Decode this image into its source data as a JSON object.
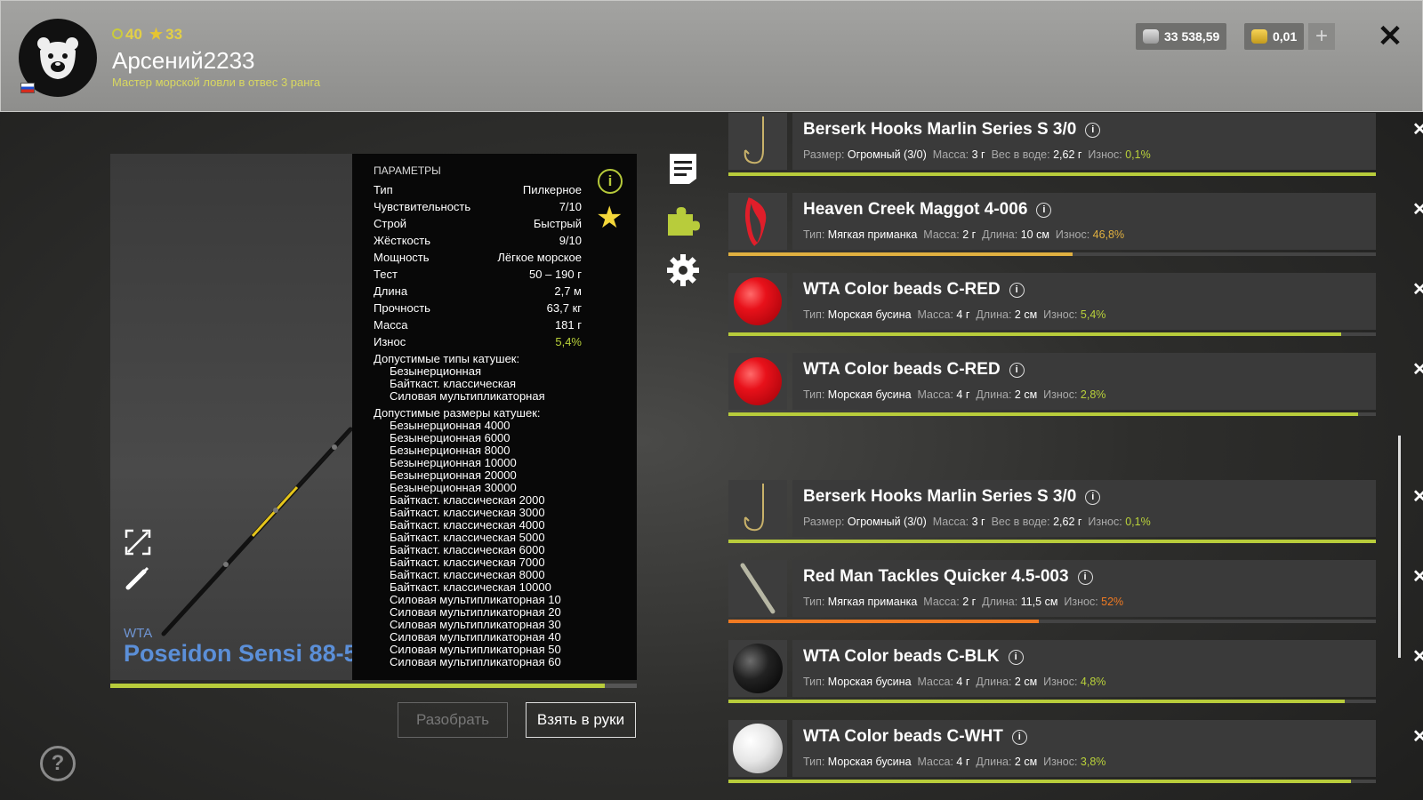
{
  "header": {
    "level": "40",
    "stars": "33",
    "username": "Арсений2233",
    "rank": "Мастер морской ловли в отвес 3 ранга",
    "silver": "33 538,59",
    "gold": "0,01",
    "plus_label": "+",
    "close_label": "✕"
  },
  "rod": {
    "brand": "WTA",
    "name": "Poseidon Sensi 88-5",
    "wear_fraction": 0.94
  },
  "params": {
    "title": "ПАРАМЕТРЫ",
    "rows": [
      {
        "k": "Тип",
        "v": "Пилкерное"
      },
      {
        "k": "Чувствительность",
        "v": "7/10"
      },
      {
        "k": "Строй",
        "v": "Быстрый"
      },
      {
        "k": "Жёсткость",
        "v": "9/10"
      },
      {
        "k": "Мощность",
        "v": "Лёгкое морское"
      },
      {
        "k": "Тест",
        "v": "50 – 190 г"
      },
      {
        "k": "Длина",
        "v": "2,7 м"
      },
      {
        "k": "Прочность",
        "v": "63,7 кг"
      },
      {
        "k": "Масса",
        "v": "181 г"
      },
      {
        "k": "Износ",
        "v": "5,4%"
      }
    ],
    "reel_types_title": "Допустимые типы катушек:",
    "reel_types": [
      "Безынерционная",
      "Байткаст. классическая",
      "Силовая мультипликаторная"
    ],
    "reel_sizes_title": "Допустимые размеры катушек:",
    "reel_sizes": [
      "Безынерционная 4000",
      "Безынерционная 6000",
      "Безынерционная 8000",
      "Безынерционная 10000",
      "Безынерционная 20000",
      "Безынерционная 30000",
      "Байткаст. классическая 2000",
      "Байткаст. классическая 3000",
      "Байткаст. классическая 4000",
      "Байткаст. классическая 5000",
      "Байткаст. классическая 6000",
      "Байткаст. классическая 7000",
      "Байткаст. классическая 8000",
      "Байткаст. классическая 10000",
      "Силовая мультипликаторная 10",
      "Силовая мультипликаторная 20",
      "Силовая мультипликаторная 30",
      "Силовая мультипликаторная 40",
      "Силовая мультипликаторная 50",
      "Силовая мультипликаторная 60"
    ]
  },
  "buttons": {
    "disassemble": "Разобрать",
    "take": "Взять в руки",
    "help": "?"
  },
  "items": [
    {
      "name": "Berserk Hooks Marlin Series S 3/0",
      "thumb": "hook-icon",
      "props": [
        [
          "Размер:",
          "Огромный (3/0)"
        ],
        [
          "Масса:",
          "3 г"
        ],
        [
          "Вес в воде:",
          "2,62 г"
        ]
      ],
      "wear_label": "Износ:",
      "wear": "0,1%",
      "wear_class": "good",
      "bar": 1.0,
      "bar_color": "#b8cc3b"
    },
    {
      "name": "Heaven Creek Maggot 4-006",
      "thumb": "maggot-icon",
      "props": [
        [
          "Тип:",
          "Мягкая приманка"
        ],
        [
          "Масса:",
          "2 г"
        ],
        [
          "Длина:",
          "10 см"
        ]
      ],
      "wear_label": "Износ:",
      "wear": "46,8%",
      "wear_class": "mid",
      "bar": 0.532,
      "bar_color": "#e0b040"
    },
    {
      "name": "WTA Color beads C-RED",
      "thumb": "bead-red",
      "props": [
        [
          "Тип:",
          "Морская бусина"
        ],
        [
          "Масса:",
          "4 г"
        ],
        [
          "Длина:",
          "2 см"
        ]
      ],
      "wear_label": "Износ:",
      "wear": "5,4%",
      "wear_class": "good",
      "bar": 0.946,
      "bar_color": "#b8cc3b"
    },
    {
      "name": "WTA Color beads C-RED",
      "thumb": "bead-red",
      "props": [
        [
          "Тип:",
          "Морская бусина"
        ],
        [
          "Масса:",
          "4 г"
        ],
        [
          "Длина:",
          "2 см"
        ]
      ],
      "wear_label": "Износ:",
      "wear": "2,8%",
      "wear_class": "good",
      "bar": 0.972,
      "bar_color": "#b8cc3b"
    },
    {
      "name": "Berserk Hooks Marlin Series S 3/0",
      "thumb": "hook-icon",
      "props": [
        [
          "Размер:",
          "Огромный (3/0)"
        ],
        [
          "Масса:",
          "3 г"
        ],
        [
          "Вес в воде:",
          "2,62 г"
        ]
      ],
      "wear_label": "Износ:",
      "wear": "0,1%",
      "wear_class": "good",
      "bar": 1.0,
      "bar_color": "#b8cc3b"
    },
    {
      "name": "Red Man Tackles Quicker 4.5-003",
      "thumb": "worm-icon",
      "props": [
        [
          "Тип:",
          "Мягкая приманка"
        ],
        [
          "Масса:",
          "2 г"
        ],
        [
          "Длина:",
          "11,5 см"
        ]
      ],
      "wear_label": "Износ:",
      "wear": "52%",
      "wear_class": "bad",
      "bar": 0.48,
      "bar_color": "#f07a22"
    },
    {
      "name": "WTA Color beads C-BLK",
      "thumb": "bead-blk",
      "props": [
        [
          "Тип:",
          "Морская бусина"
        ],
        [
          "Масса:",
          "4 г"
        ],
        [
          "Длина:",
          "2 см"
        ]
      ],
      "wear_label": "Износ:",
      "wear": "4,8%",
      "wear_class": "good",
      "bar": 0.952,
      "bar_color": "#b8cc3b"
    },
    {
      "name": "WTA Color beads C-WHT",
      "thumb": "bead-wht",
      "props": [
        [
          "Тип:",
          "Морская бусина"
        ],
        [
          "Масса:",
          "4 г"
        ],
        [
          "Длина:",
          "2 см"
        ]
      ],
      "wear_label": "Износ:",
      "wear": "3,8%",
      "wear_class": "good",
      "bar": 0.962,
      "bar_color": "#b8cc3b"
    }
  ]
}
